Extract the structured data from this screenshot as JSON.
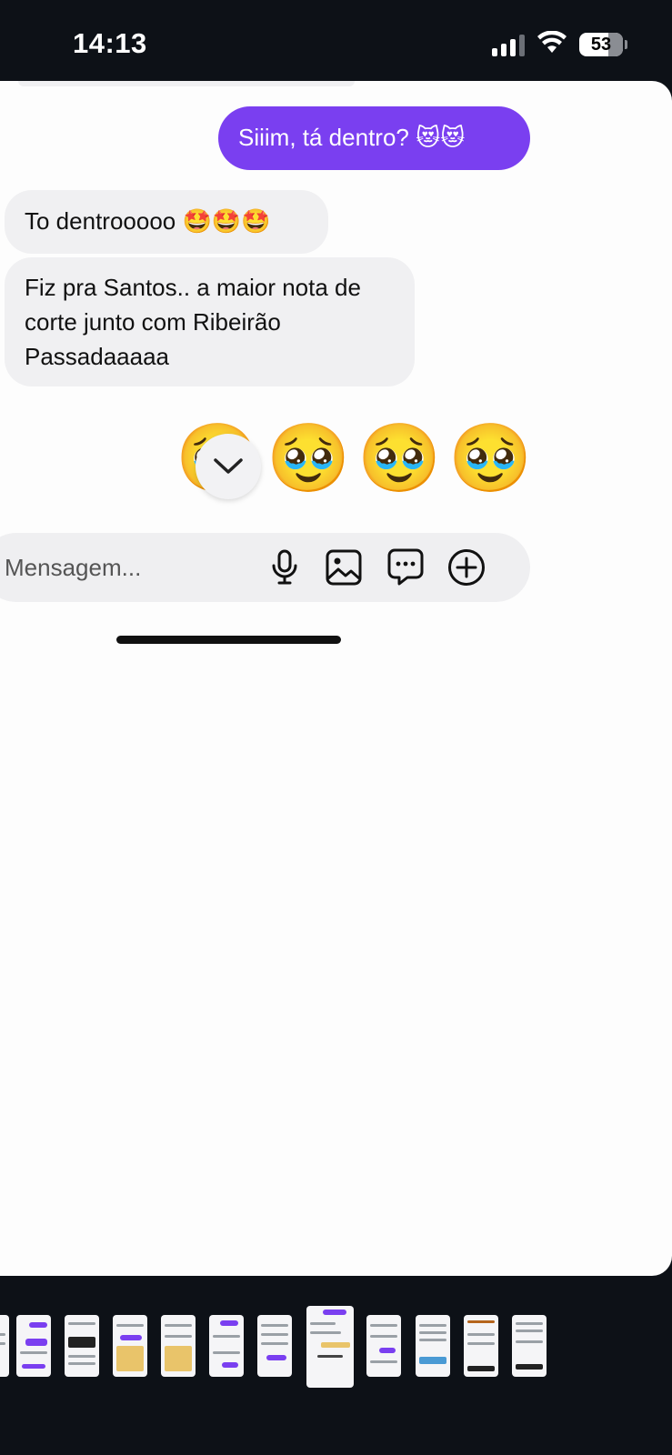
{
  "status_bar": {
    "time": "14:13",
    "battery": "53",
    "icons": [
      "cellular-signal-icon",
      "wifi-icon",
      "battery-icon"
    ]
  },
  "chat": {
    "messages": [
      {
        "direction": "outgoing",
        "text": "Siiim, tá dentro? 😻😻"
      },
      {
        "direction": "incoming",
        "text": "To dentrooooo 🤩🤩🤩"
      },
      {
        "direction": "incoming",
        "lines": [
          "Fiz pra Santos.. a maior nota de",
          "corte junto com Ribeirão",
          "Passadaaaaa"
        ]
      }
    ],
    "reaction_emojis": "🥹🥹🥹🥹",
    "scroll_down_icon": "chevron-down-icon"
  },
  "composer": {
    "placeholder": "Mensagem...",
    "icons": [
      "microphone-icon",
      "image-icon",
      "sticker-chat-icon",
      "add-circle-icon"
    ]
  },
  "colors": {
    "outgoing_bubble": "#7a3ff0",
    "incoming_bubble": "#f0f0f2",
    "background": "#0d1117"
  },
  "filmstrip": {
    "thumbnail_count": 12,
    "active_index": 7
  }
}
